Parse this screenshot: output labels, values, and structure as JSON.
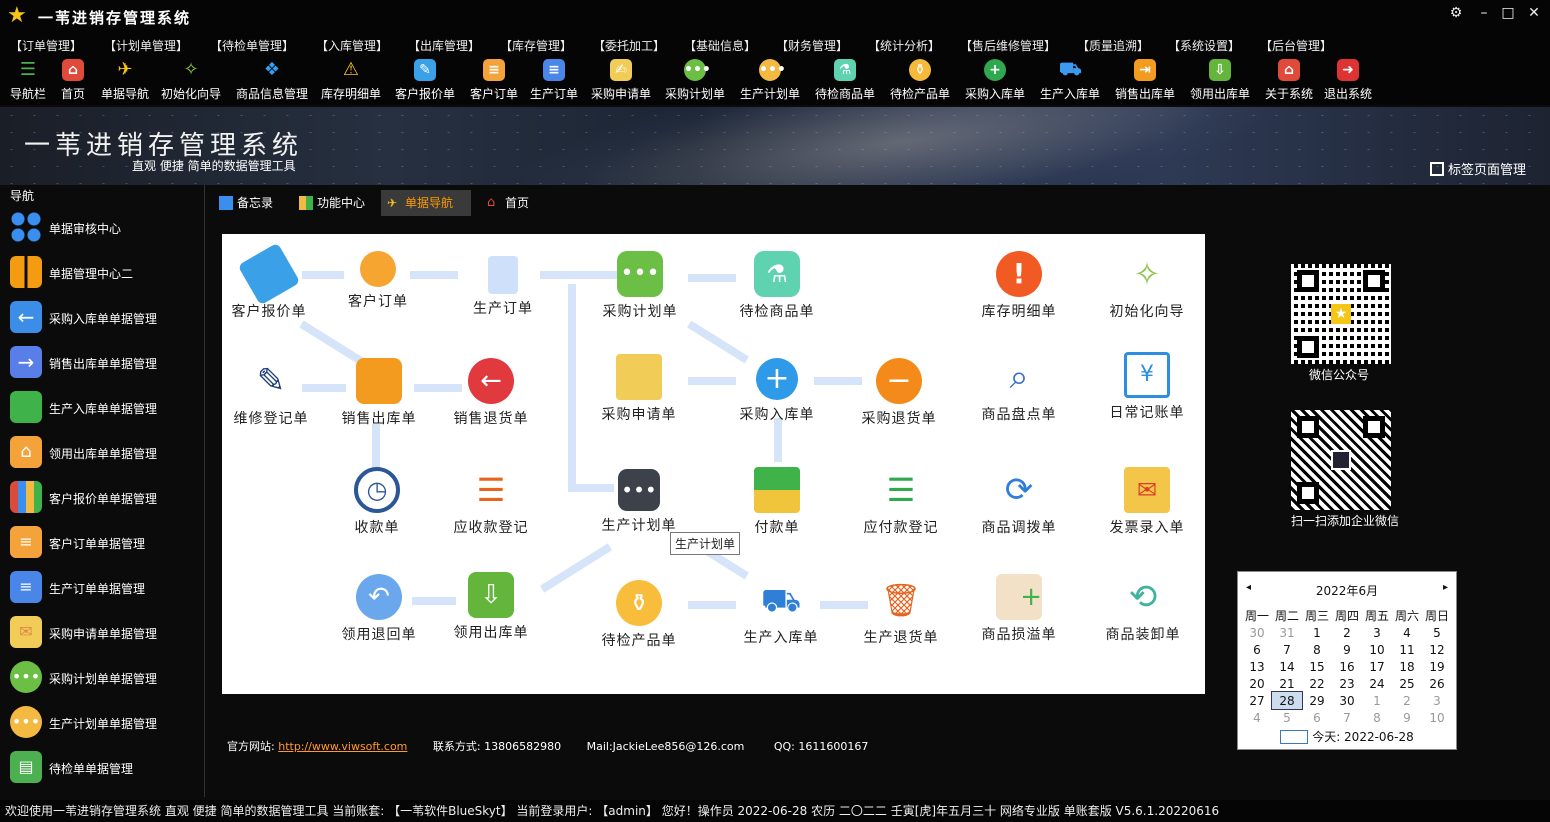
{
  "window": {
    "title": "一苇进销存管理系统"
  },
  "menu": [
    "【订单管理】",
    "【计划单管理】",
    "【待检单管理】",
    "【入库管理】",
    "【出库管理】",
    "【库存管理】",
    "【委托加工】",
    "【基础信息】",
    "【财务管理】",
    "【统计分析】",
    "【售后维修管理】",
    "【质量追溯】",
    "【系统设置】",
    "【后台管理】"
  ],
  "toolbar": [
    "导航栏",
    "首页",
    "单据导航",
    "初始化向导",
    "商品信息管理",
    "库存明细单",
    "客户报价单",
    "客户订单",
    "生产订单",
    "采购申请单",
    "采购计划单",
    "生产计划单",
    "待检商品单",
    "待检产品单",
    "采购入库单",
    "生产入库单",
    "销售出库单",
    "领用出库单",
    "关于系统",
    "退出系统"
  ],
  "banner": {
    "title": "一苇进销存管理系统",
    "subtitle": "直观 便捷 简单的数据管理工具",
    "tab_manager": "标签页面管理"
  },
  "sidebar": {
    "header": "导航",
    "items": [
      "单据审核中心",
      "单据管理中心二",
      "采购入库单单据管理",
      "销售出库单单据管理",
      "生产入库单单据管理",
      "领用出库单单据管理",
      "客户报价单单据管理",
      "客户订单单据管理",
      "生产订单单据管理",
      "采购申请单单据管理",
      "采购计划单单据管理",
      "生产计划单单据管理",
      "待检单单据管理"
    ]
  },
  "tabs": [
    "备忘录",
    "功能中心",
    "单据导航",
    "首页"
  ],
  "nodes": [
    "客户报价单",
    "客户订单",
    "生产订单",
    "采购计划单",
    "待检商品单",
    "库存明细单",
    "初始化向导",
    "维修登记单",
    "销售出库单",
    "销售退货单",
    "采购申请单",
    "采购入库单",
    "采购退货单",
    "商品盘点单",
    "日常记账单",
    "收款单",
    "应收款登记",
    "生产计划单",
    "付款单",
    "应付款登记",
    "商品调拨单",
    "发票录入单",
    "领用退回单",
    "领用出库单",
    "待检产品单",
    "生产入库单",
    "生产退货单",
    "商品损溢单",
    "商品装卸单"
  ],
  "tooltip": "生产计划单",
  "qr": {
    "wechat_caption": "微信公众号",
    "enterprise_caption": "扫一扫添加企业微信"
  },
  "calendar": {
    "month": "2022年6月",
    "prev": "◂",
    "next": "▸",
    "weekdays": [
      "周一",
      "周二",
      "周三",
      "周四",
      "周五",
      "周六",
      "周日"
    ],
    "days": [
      [
        "30",
        "31",
        "1",
        "2",
        "3",
        "4",
        "5"
      ],
      [
        "6",
        "7",
        "8",
        "9",
        "10",
        "11",
        "12"
      ],
      [
        "13",
        "14",
        "15",
        "16",
        "17",
        "18",
        "19"
      ],
      [
        "20",
        "21",
        "22",
        "23",
        "24",
        "25",
        "26"
      ],
      [
        "27",
        "28",
        "29",
        "30",
        "1",
        "2",
        "3"
      ],
      [
        "4",
        "5",
        "6",
        "7",
        "8",
        "9",
        "10"
      ]
    ],
    "today": "今天: 2022-06-28"
  },
  "footer": {
    "site_label": "官方网站:",
    "site_url": "http://www.viwsoft.com",
    "contact": "联系方式: 13806582980",
    "mail": "Mail:JackieLee856@126.com",
    "qq": "QQ: 1611600167"
  },
  "status": {
    "text": "欢迎使用一苇进销存管理系统   直观 便捷 简单的数据管理工具    当前账套: 【一苇软件BlueSkyt】   当前登录用户: 【admin】 您好！操作员  2022-06-28  农历 二〇二二 壬寅[虎]年五月三十    网络专业版   单账套版   V5.6.1.20220616"
  },
  "colors": {
    "accent_orange": "#ff9900",
    "link": "#ff9a2a",
    "canvas": "#ffffff"
  }
}
